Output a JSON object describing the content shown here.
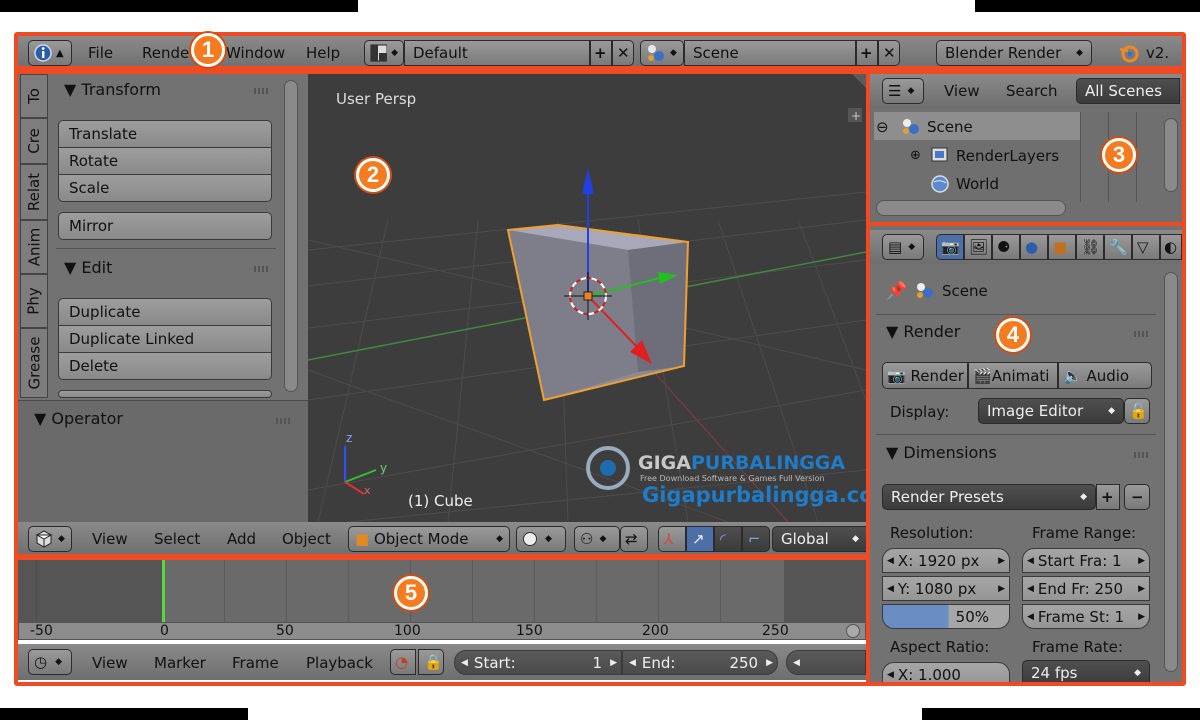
{
  "badges": {
    "b1": "1",
    "b2": "2",
    "b3": "3",
    "b4": "4",
    "b5": "5"
  },
  "topbar": {
    "menu": [
      "File",
      "Render",
      "Window",
      "Help"
    ],
    "layout": "Default",
    "scene": "Scene",
    "engine": "Blender Render",
    "version": "v2."
  },
  "toolshelf": {
    "tabs": [
      "To",
      "Cre",
      "Relat",
      "Anim",
      "Phy",
      "Grease"
    ],
    "transform_header": "Transform",
    "transform_buttons": [
      "Translate",
      "Rotate",
      "Scale"
    ],
    "mirror": "Mirror",
    "edit_header": "Edit",
    "edit_buttons": [
      "Duplicate",
      "Duplicate Linked",
      "Delete"
    ],
    "operator_header": "Operator"
  },
  "viewport": {
    "label": "User Persp",
    "object": "(1) Cube",
    "watermark_brand1": "GIGA",
    "watermark_brand2": "PURBALINGGA",
    "watermark_tagline": "Free Download Software & Games Full Version",
    "watermark_url": "Gigapurbalingga.cc"
  },
  "view3d_header": {
    "menu": [
      "View",
      "Select",
      "Add",
      "Object"
    ],
    "mode": "Object Mode",
    "orientation": "Global"
  },
  "outliner": {
    "header": [
      "View",
      "Search"
    ],
    "filter": "All Scenes",
    "tree": [
      "Scene",
      "RenderLayers",
      "World"
    ]
  },
  "properties": {
    "context": "Scene",
    "render_header": "Render",
    "render_buttons": [
      "Render",
      "Animati",
      "Audio"
    ],
    "display_label": "Display:",
    "display_value": "Image Editor",
    "dimensions_header": "Dimensions",
    "presets": "Render Presets",
    "resolution_label": "Resolution:",
    "res_x": "X:  1920 px",
    "res_y": "Y:  1080 px",
    "res_pct": "50%",
    "frame_range_label": "Frame Range:",
    "start_frame": "Start Fra:  1",
    "end_frame": "End Fr:  250",
    "frame_step": "Frame St:  1",
    "aspect_label": "Aspect Ratio:",
    "aspect_x": "X:   1.000",
    "framerate_label": "Frame Rate:",
    "framerate": "24 fps"
  },
  "timeline": {
    "ticks": [
      "-50",
      "0",
      "50",
      "100",
      "150",
      "200",
      "250"
    ],
    "menu": [
      "View",
      "Marker",
      "Frame",
      "Playback"
    ],
    "start_label": "Start:",
    "start_value": "1",
    "end_label": "End:",
    "end_value": "250"
  },
  "colors": {
    "frame": "#ee4a23",
    "badge": "#f57b21",
    "viewport": "#3d3d3d",
    "panel": "#727272",
    "header": "#7a7a7a",
    "selection": "#f0a030"
  }
}
